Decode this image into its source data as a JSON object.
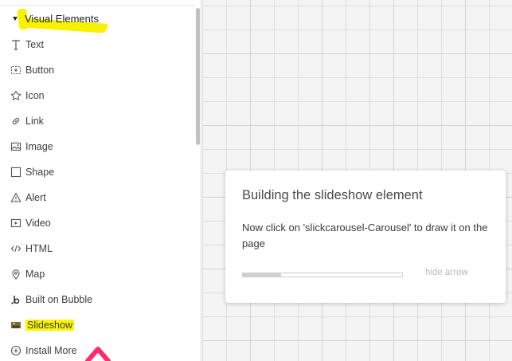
{
  "sidebar": {
    "section_title": "Visual Elements",
    "items": [
      {
        "label": "Text",
        "icon": "text-icon"
      },
      {
        "label": "Button",
        "icon": "button-icon"
      },
      {
        "label": "Icon",
        "icon": "star-icon"
      },
      {
        "label": "Link",
        "icon": "link-icon"
      },
      {
        "label": "Image",
        "icon": "image-icon"
      },
      {
        "label": "Shape",
        "icon": "shape-icon"
      },
      {
        "label": "Alert",
        "icon": "alert-icon"
      },
      {
        "label": "Video",
        "icon": "video-icon"
      },
      {
        "label": "HTML",
        "icon": "html-icon"
      },
      {
        "label": "Map",
        "icon": "map-pin-icon"
      },
      {
        "label": "Built on Bubble",
        "icon": "bubble-logo-icon"
      },
      {
        "label": "Slideshow",
        "icon": "slideshow-icon"
      },
      {
        "label": "Install More",
        "icon": "plus-circle-icon"
      }
    ]
  },
  "popup": {
    "title": "Building the slideshow element",
    "body": "Now click on 'slickcarousel-Carousel' to draw it on the page",
    "progress": 0.24,
    "hide_label": "hide arrow"
  },
  "colors": {
    "highlight": "#fbf500",
    "annotation_arrow": "#ff2c6b",
    "canvas_bg": "#f4f4f4"
  }
}
